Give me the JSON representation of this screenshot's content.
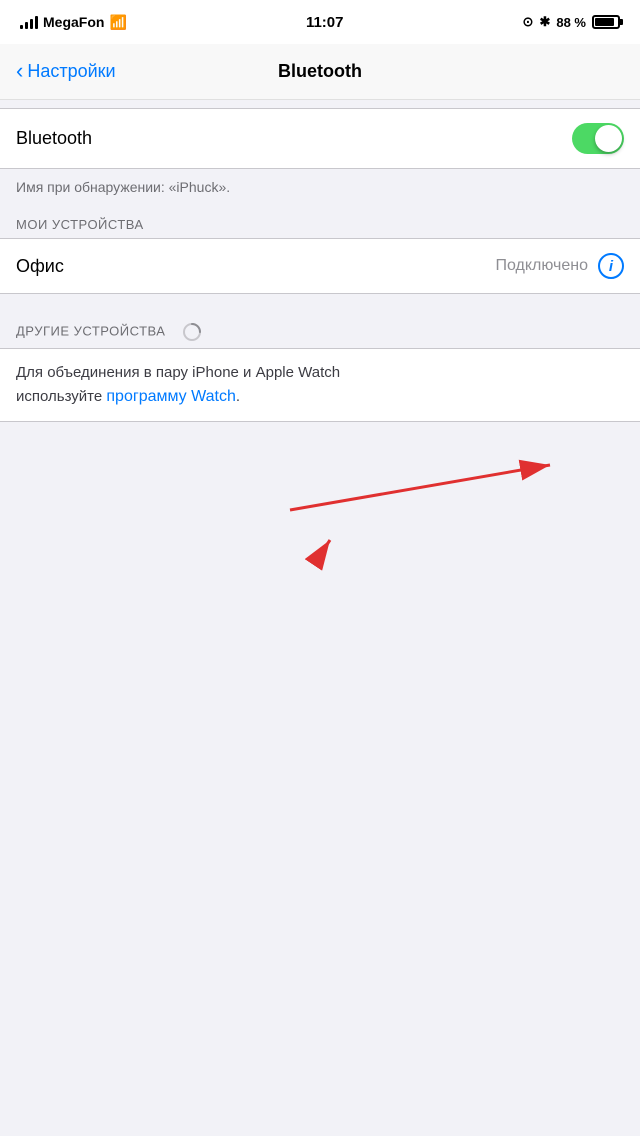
{
  "statusBar": {
    "carrier": "MegaFon",
    "time": "11:07",
    "battery": "88 %"
  },
  "navBar": {
    "backLabel": "Настройки",
    "title": "Bluetooth"
  },
  "bluetooth": {
    "label": "Bluetooth",
    "toggleOn": true,
    "discoveryText": "Имя при обнаружении: «iPhuck»."
  },
  "myDevices": {
    "sectionHeader": "МОИ УСТРОЙСТВА",
    "devices": [
      {
        "name": "Офис",
        "status": "Подключено"
      }
    ]
  },
  "otherDevices": {
    "sectionHeader": "ДРУГИЕ УСТРОЙСТВА",
    "watchText1": "Для объединения в пару iPhone и Apple Watch",
    "watchText2": "используйте ",
    "watchLink": "программу Watch",
    "watchTextEnd": "."
  }
}
